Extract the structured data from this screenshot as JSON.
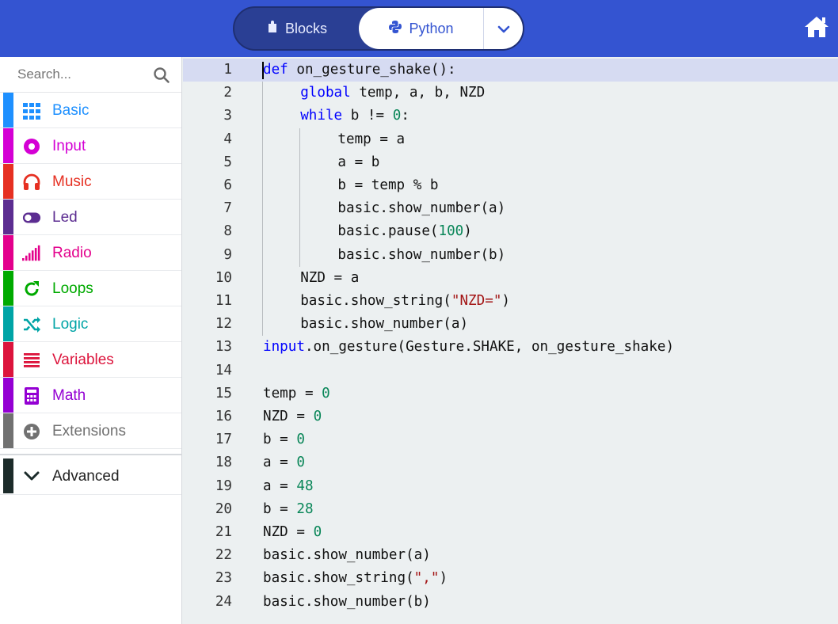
{
  "header": {
    "tabs": [
      {
        "label": "Blocks",
        "icon": "puzzle-icon",
        "active": false
      },
      {
        "label": "Python",
        "icon": "python-icon",
        "active": true
      }
    ],
    "dropdown_icon": "chevron-down-icon",
    "home_icon": "home-icon",
    "colors": {
      "bar": "#3454d1",
      "toggle": "#2a3f94",
      "active_text": "#3454d1"
    }
  },
  "sidebar": {
    "search_placeholder": "Search...",
    "categories": [
      {
        "label": "Basic",
        "color": "#1e90ff",
        "icon": "grid-icon"
      },
      {
        "label": "Input",
        "color": "#d400d4",
        "icon": "target-icon"
      },
      {
        "label": "Music",
        "color": "#e63022",
        "icon": "headphones-icon"
      },
      {
        "label": "Led",
        "color": "#5c2d91",
        "icon": "toggle-icon"
      },
      {
        "label": "Radio",
        "color": "#e3008c",
        "icon": "signal-bars-icon"
      },
      {
        "label": "Loops",
        "color": "#00aa00",
        "icon": "refresh-icon"
      },
      {
        "label": "Logic",
        "color": "#00a4a6",
        "icon": "shuffle-icon"
      },
      {
        "label": "Variables",
        "color": "#dc143c",
        "icon": "list-icon"
      },
      {
        "label": "Math",
        "color": "#9400d3",
        "icon": "calculator-icon"
      },
      {
        "label": "Extensions",
        "color": "#717171",
        "icon": "plus-circle-icon"
      }
    ],
    "advanced": {
      "label": "Advanced",
      "icon": "chevron-down-icon"
    }
  },
  "editor": {
    "active_line": 1,
    "lines": [
      {
        "n": "1",
        "indent": 0,
        "tokens": [
          [
            "kw",
            "def"
          ],
          [
            "t",
            " on_gesture_shake():"
          ]
        ]
      },
      {
        "n": "2",
        "indent": 1,
        "tokens": [
          [
            "kw",
            "global"
          ],
          [
            "t",
            " temp, a, b, NZD"
          ]
        ]
      },
      {
        "n": "3",
        "indent": 1,
        "tokens": [
          [
            "kw",
            "while"
          ],
          [
            "t",
            " b != "
          ],
          [
            "num",
            "0"
          ],
          [
            "t",
            ":"
          ]
        ]
      },
      {
        "n": "4",
        "indent": 2,
        "tokens": [
          [
            "t",
            "temp = a"
          ]
        ]
      },
      {
        "n": "5",
        "indent": 2,
        "tokens": [
          [
            "t",
            "a = b"
          ]
        ]
      },
      {
        "n": "6",
        "indent": 2,
        "tokens": [
          [
            "t",
            "b = temp % b"
          ]
        ]
      },
      {
        "n": "7",
        "indent": 2,
        "tokens": [
          [
            "t",
            "basic.show_number(a)"
          ]
        ]
      },
      {
        "n": "8",
        "indent": 2,
        "tokens": [
          [
            "t",
            "basic.pause("
          ],
          [
            "num",
            "100"
          ],
          [
            "t",
            ")"
          ]
        ]
      },
      {
        "n": "9",
        "indent": 2,
        "tokens": [
          [
            "t",
            "basic.show_number(b)"
          ]
        ]
      },
      {
        "n": "10",
        "indent": 1,
        "tokens": [
          [
            "t",
            "NZD = a"
          ]
        ]
      },
      {
        "n": "11",
        "indent": 1,
        "tokens": [
          [
            "t",
            "basic.show_string("
          ],
          [
            "str",
            "\"NZD=\""
          ],
          [
            "t",
            ")"
          ]
        ]
      },
      {
        "n": "12",
        "indent": 1,
        "tokens": [
          [
            "t",
            "basic.show_number(a)"
          ]
        ]
      },
      {
        "n": "13",
        "indent": 0,
        "tokens": [
          [
            "kw",
            "input"
          ],
          [
            "t",
            ".on_gesture(Gesture.SHAKE, on_gesture_shake)"
          ]
        ]
      },
      {
        "n": "14",
        "indent": 0,
        "tokens": []
      },
      {
        "n": "15",
        "indent": 0,
        "tokens": [
          [
            "t",
            "temp = "
          ],
          [
            "num",
            "0"
          ]
        ]
      },
      {
        "n": "16",
        "indent": 0,
        "tokens": [
          [
            "t",
            "NZD = "
          ],
          [
            "num",
            "0"
          ]
        ]
      },
      {
        "n": "17",
        "indent": 0,
        "tokens": [
          [
            "t",
            "b = "
          ],
          [
            "num",
            "0"
          ]
        ]
      },
      {
        "n": "18",
        "indent": 0,
        "tokens": [
          [
            "t",
            "a = "
          ],
          [
            "num",
            "0"
          ]
        ]
      },
      {
        "n": "19",
        "indent": 0,
        "tokens": [
          [
            "t",
            "a = "
          ],
          [
            "num",
            "48"
          ]
        ]
      },
      {
        "n": "20",
        "indent": 0,
        "tokens": [
          [
            "t",
            "b = "
          ],
          [
            "num",
            "28"
          ]
        ]
      },
      {
        "n": "21",
        "indent": 0,
        "tokens": [
          [
            "t",
            "NZD = "
          ],
          [
            "num",
            "0"
          ]
        ]
      },
      {
        "n": "22",
        "indent": 0,
        "tokens": [
          [
            "t",
            "basic.show_number(a)"
          ]
        ]
      },
      {
        "n": "23",
        "indent": 0,
        "tokens": [
          [
            "t",
            "basic.show_string("
          ],
          [
            "str",
            "\",\""
          ],
          [
            "t",
            ")"
          ]
        ]
      },
      {
        "n": "24",
        "indent": 0,
        "tokens": [
          [
            "t",
            "basic.show_number(b)"
          ]
        ]
      }
    ]
  }
}
